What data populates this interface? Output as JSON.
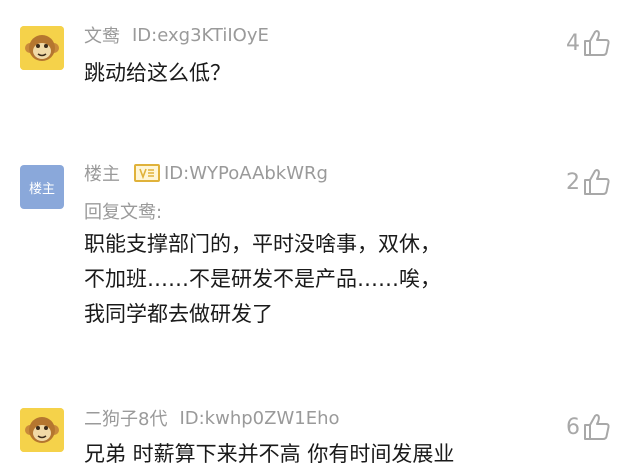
{
  "comments": [
    {
      "username": "文鸯",
      "uid": "ID:exg3KTiIOyE",
      "text_lines": [
        "跳动给这么低？"
      ],
      "likes": "4"
    },
    {
      "username": "楼主",
      "avatar_label": "楼主",
      "uid": "ID:WYPoAAbkWRg",
      "reply_to": "回复文鸯:",
      "text_lines": [
        "职能支撑部门的，平时没啥事，双休，",
        "不加班……不是研发不是产品……唉，",
        "我同学都去做研发了"
      ],
      "likes": "2"
    },
    {
      "username": "二狗子8代",
      "uid": "ID:kwhp0ZW1Eho",
      "text_lines": [
        "兄弟 时薪算下来并不高 你有时间发展业"
      ],
      "likes": "6"
    }
  ],
  "icons": {
    "like": "thumbs-up-icon",
    "verified": "verified-badge-icon",
    "avatar": "monkey-avatar-icon"
  },
  "colors": {
    "meta_gray": "#9a9a9a",
    "text": "#1a1a1a",
    "monkey_yellow": "#f5d24a",
    "owner_blue": "#8aa8da",
    "badge_gold": "#e0b23a"
  }
}
